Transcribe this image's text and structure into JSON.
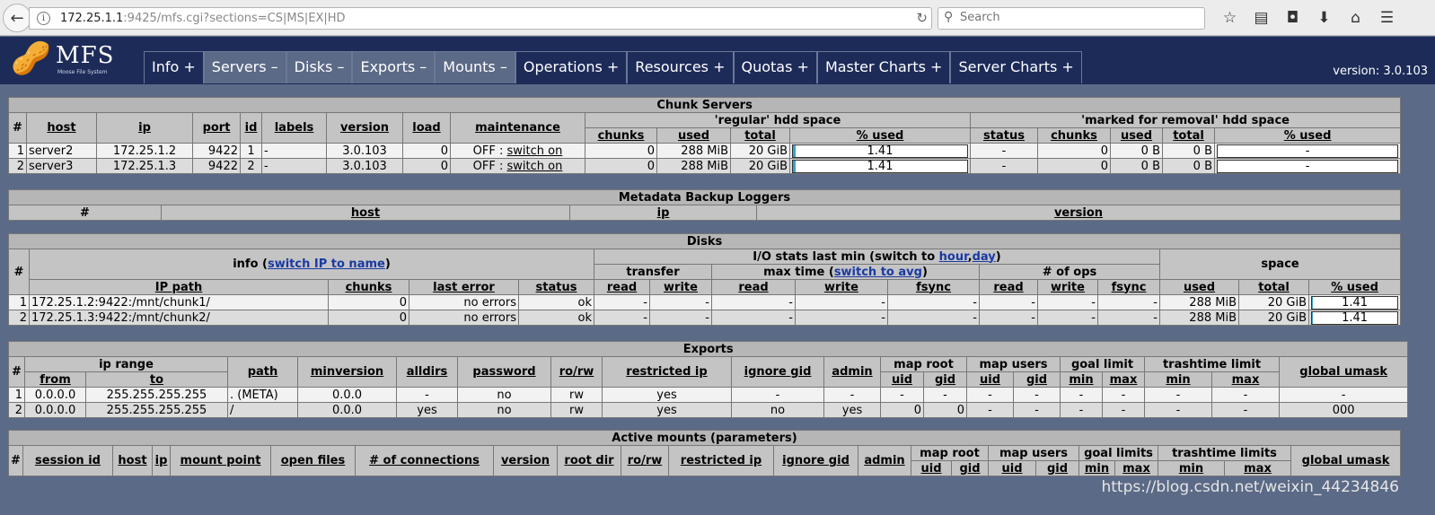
{
  "browser": {
    "url_host": "172.25.1.1",
    "url_rest": ":9425/mfs.cgi?sections=CS|MS|EX|HD",
    "search_placeholder": "Search"
  },
  "header": {
    "logo_text": "MFS",
    "logo_sub": "Moose File System",
    "version": "version: 3.0.103",
    "tabs": [
      {
        "label": "Info +",
        "selected": false
      },
      {
        "label": "Servers –",
        "selected": true
      },
      {
        "label": "Disks –",
        "selected": true
      },
      {
        "label": "Exports –",
        "selected": true
      },
      {
        "label": "Mounts –",
        "selected": true
      },
      {
        "label": "Operations +",
        "selected": false
      },
      {
        "label": "Resources +",
        "selected": false
      },
      {
        "label": "Quotas +",
        "selected": false
      },
      {
        "label": "Master Charts +",
        "selected": false
      },
      {
        "label": "Server Charts +",
        "selected": false
      }
    ]
  },
  "chunk_servers": {
    "title": "Chunk Servers",
    "regular": "'regular' hdd space",
    "marked": "'marked for removal' hdd space",
    "cols": {
      "num": "#",
      "host": "host",
      "ip": "ip",
      "port": "port",
      "id": "id",
      "labels": "labels",
      "version": "version",
      "load": "load",
      "maintenance": "maintenance",
      "chunks": "chunks",
      "used": "used",
      "total": "total",
      "pct": "% used",
      "status": "status"
    },
    "rows": [
      {
        "num": "1",
        "host": "server2",
        "ip": "172.25.1.2",
        "port": "9422",
        "id": "1",
        "labels": "-",
        "version": "3.0.103",
        "load": "0",
        "maint_state": "OFF : ",
        "maint_link": "switch on",
        "chunks": "0",
        "used": "288 MiB",
        "total": "20 GiB",
        "pct": "1.41",
        "pct_value": 1.41,
        "m_status": "-",
        "m_chunks": "0",
        "m_used": "0 B",
        "m_total": "0 B",
        "m_pct": "-"
      },
      {
        "num": "2",
        "host": "server3",
        "ip": "172.25.1.3",
        "port": "9422",
        "id": "2",
        "labels": "-",
        "version": "3.0.103",
        "load": "0",
        "maint_state": "OFF : ",
        "maint_link": "switch on",
        "chunks": "0",
        "used": "288 MiB",
        "total": "20 GiB",
        "pct": "1.41",
        "pct_value": 1.41,
        "m_status": "-",
        "m_chunks": "0",
        "m_used": "0 B",
        "m_total": "0 B",
        "m_pct": "-"
      }
    ]
  },
  "metadata": {
    "title": "Metadata Backup Loggers",
    "cols": {
      "num": "#",
      "host": "host",
      "ip": "ip",
      "version": "version"
    }
  },
  "disks": {
    "title": "Disks",
    "info_prefix": "info (",
    "info_link": "switch IP to name",
    "info_suffix": ")",
    "io_prefix": "I/O stats last min (switch to ",
    "io_hour": "hour",
    "io_comma": ",",
    "io_day": "day",
    "io_suffix": ")",
    "transfer": "transfer",
    "maxtime_prefix": "max time (",
    "maxtime_link": "switch to avg",
    "maxtime_suffix": ")",
    "ops": "# of ops",
    "space": "space",
    "cols": {
      "num": "#",
      "ip_path": "IP path",
      "chunks": "chunks",
      "last_error": "last error",
      "status": "status",
      "read": "read",
      "write": "write",
      "fsync": "fsync",
      "used": "used",
      "total": "total",
      "pct": "% used"
    },
    "rows": [
      {
        "num": "1",
        "path": "172.25.1.2:9422:/mnt/chunk1/",
        "chunks": "0",
        "last_error": "no errors",
        "status": "ok",
        "tr": "-",
        "tw": "-",
        "mr": "-",
        "mw": "-",
        "mf": "-",
        "or": "-",
        "ow": "-",
        "of": "-",
        "used": "288 MiB",
        "total": "20 GiB",
        "pct": "1.41",
        "pct_value": 1.41
      },
      {
        "num": "2",
        "path": "172.25.1.3:9422:/mnt/chunk2/",
        "chunks": "0",
        "last_error": "no errors",
        "status": "ok",
        "tr": "-",
        "tw": "-",
        "mr": "-",
        "mw": "-",
        "mf": "-",
        "or": "-",
        "ow": "-",
        "of": "-",
        "used": "288 MiB",
        "total": "20 GiB",
        "pct": "1.41",
        "pct_value": 1.41
      }
    ]
  },
  "exports": {
    "title": "Exports",
    "cols": {
      "num": "#",
      "ip_range": "ip range",
      "from": "from",
      "to": "to",
      "path": "path",
      "minversion": "minversion",
      "alldirs": "alldirs",
      "password": "password",
      "rorw": "ro/rw",
      "restricted_ip": "restricted ip",
      "ignore_gid": "ignore gid",
      "admin": "admin",
      "map_root": "map root",
      "map_users": "map users",
      "goal_limit": "goal limit",
      "trashtime_limit": "trashtime limit",
      "global_umask": "global umask",
      "uid": "uid",
      "gid": "gid",
      "min": "min",
      "max": "max"
    },
    "rows": [
      {
        "num": "1",
        "from": "0.0.0.0",
        "to": "255.255.255.255",
        "path": ". (META)",
        "minversion": "0.0.0",
        "alldirs": "-",
        "password": "no",
        "rorw": "rw",
        "restricted_ip": "yes",
        "ignore_gid": "-",
        "admin": "-",
        "mr_uid": "-",
        "mr_gid": "-",
        "mu_uid": "-",
        "mu_gid": "-",
        "g_min": "-",
        "g_max": "-",
        "t_min": "-",
        "t_max": "-",
        "umask": "-"
      },
      {
        "num": "2",
        "from": "0.0.0.0",
        "to": "255.255.255.255",
        "path": "/",
        "minversion": "0.0.0",
        "alldirs": "yes",
        "password": "no",
        "rorw": "rw",
        "restricted_ip": "yes",
        "ignore_gid": "no",
        "admin": "yes",
        "mr_uid": "0",
        "mr_gid": "0",
        "mu_uid": "-",
        "mu_gid": "-",
        "g_min": "-",
        "g_max": "-",
        "t_min": "-",
        "t_max": "-",
        "umask": "000"
      }
    ]
  },
  "mounts": {
    "title": "Active mounts (parameters)",
    "cols": {
      "num": "#",
      "session_id": "session id",
      "host": "host",
      "ip": "ip",
      "mount_point": "mount point",
      "open_files": "open files",
      "connections": "# of connections",
      "version": "version",
      "root_dir": "root dir",
      "rorw": "ro/rw",
      "restricted_ip": "restricted ip",
      "ignore_gid": "ignore gid",
      "admin": "admin",
      "map_root": "map root",
      "map_users": "map users",
      "goal_limits": "goal limits",
      "trashtime_limits": "trashtime limits",
      "global_umask": "global umask",
      "uid": "uid",
      "gid": "gid",
      "min": "min",
      "max": "max"
    }
  },
  "watermark": "https://blog.csdn.net/weixin_44234846"
}
